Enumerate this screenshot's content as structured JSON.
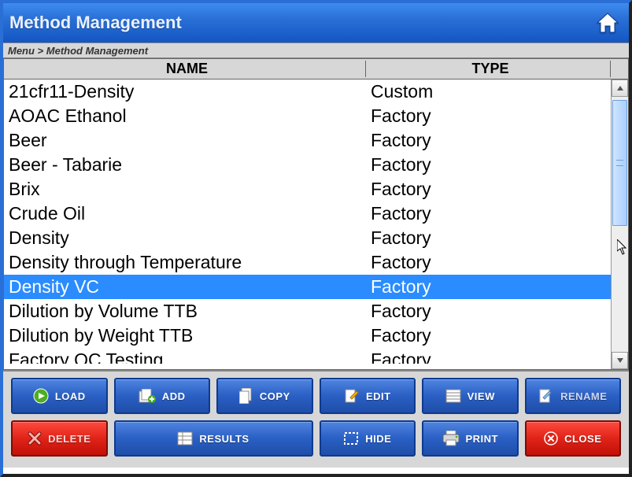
{
  "title": "Method Management",
  "breadcrumb": "Menu > Method Management",
  "columns": {
    "name": "NAME",
    "type": "TYPE"
  },
  "rows": [
    {
      "name": "21cfr11-Density",
      "type": "Custom"
    },
    {
      "name": "AOAC Ethanol",
      "type": "Factory"
    },
    {
      "name": "Beer",
      "type": "Factory"
    },
    {
      "name": "Beer - Tabarie",
      "type": "Factory"
    },
    {
      "name": "Brix",
      "type": "Factory"
    },
    {
      "name": "Crude Oil",
      "type": "Factory"
    },
    {
      "name": "Density",
      "type": "Factory"
    },
    {
      "name": "Density through Temperature",
      "type": "Factory"
    },
    {
      "name": "Density VC",
      "type": "Factory",
      "selected": true
    },
    {
      "name": "Dilution by Volume TTB",
      "type": "Factory"
    },
    {
      "name": "Dilution by Weight TTB",
      "type": "Factory"
    },
    {
      "name": "Factory QC Testing",
      "type": "Factory",
      "partial": true
    }
  ],
  "buttons": {
    "load": "LOAD",
    "add": "ADD",
    "copy": "COPY",
    "edit": "EDIT",
    "view": "VIEW",
    "rename": "RENAME",
    "delete": "DELETE",
    "results": "RESULTS",
    "hide": "HIDE",
    "print": "PRINT",
    "close": "CLOSE"
  }
}
